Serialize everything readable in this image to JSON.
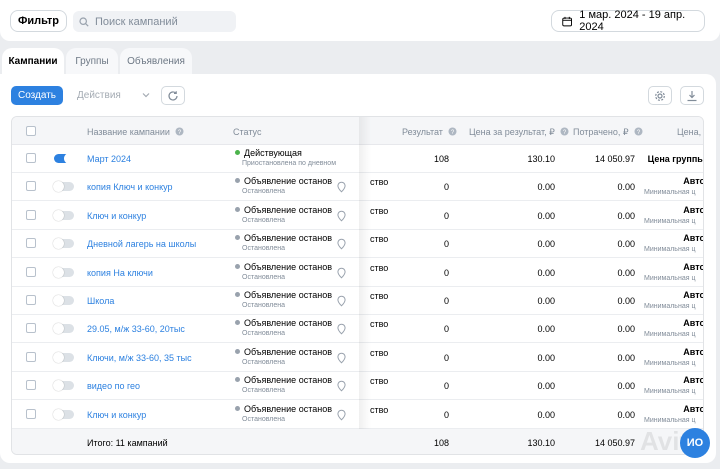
{
  "toolbar": {
    "filter_label": "Фильтр",
    "search_placeholder": "Поиск кампаний",
    "date_range": "1 мар. 2024 - 19 апр. 2024"
  },
  "tabs": [
    {
      "label": "Кампании",
      "active": true
    },
    {
      "label": "Группы",
      "active": false
    },
    {
      "label": "Объявления",
      "active": false
    }
  ],
  "actions": {
    "create_label": "Создать",
    "actions_label": "Действия"
  },
  "table": {
    "columns": {
      "name": "Название кампании",
      "status": "Статус",
      "result": "Результат",
      "cost_per_result": "Цена за результат, ₽",
      "spent": "Потрачено, ₽",
      "price": "Цена,"
    },
    "rows": [
      {
        "name": "Март 2024",
        "enabled": true,
        "status": "Действующая",
        "status_sub": "Приостановлена по дневном",
        "status_color": "#4bb34b",
        "obj": "",
        "result": "108",
        "cpr": "130.10",
        "spent": "14 050.97",
        "bid": "Цена группы",
        "bid_sub": ""
      },
      {
        "name": "копия Ключ и конкур",
        "enabled": false,
        "status": "Объявление останов",
        "status_sub": "Остановлена",
        "status_color": "#99a2ad",
        "obj": "ство",
        "result": "0",
        "cpr": "0.00",
        "spent": "0.00",
        "bid": "Авто",
        "bid_sub": "Минимальная ц"
      },
      {
        "name": "Ключ и конкур",
        "enabled": false,
        "status": "Объявление останов",
        "status_sub": "Остановлена",
        "status_color": "#99a2ad",
        "obj": "ство",
        "result": "0",
        "cpr": "0.00",
        "spent": "0.00",
        "bid": "Авто",
        "bid_sub": "Минимальная ц"
      },
      {
        "name": "Дневной лагерь на школы",
        "enabled": false,
        "status": "Объявление останов",
        "status_sub": "Остановлена",
        "status_color": "#99a2ad",
        "obj": "ство",
        "result": "0",
        "cpr": "0.00",
        "spent": "0.00",
        "bid": "Авто",
        "bid_sub": "Минимальная ц"
      },
      {
        "name": "копия На ключи",
        "enabled": false,
        "status": "Объявление останов",
        "status_sub": "Остановлена",
        "status_color": "#99a2ad",
        "obj": "ство",
        "result": "0",
        "cpr": "0.00",
        "spent": "0.00",
        "bid": "Авто",
        "bid_sub": "Минимальная ц"
      },
      {
        "name": "Школа",
        "enabled": false,
        "status": "Объявление останов",
        "status_sub": "Остановлена",
        "status_color": "#99a2ad",
        "obj": "ство",
        "result": "0",
        "cpr": "0.00",
        "spent": "0.00",
        "bid": "Авто",
        "bid_sub": "Минимальная ц"
      },
      {
        "name": "29.05, м/ж 33-60, 20тыс",
        "enabled": false,
        "status": "Объявление останов",
        "status_sub": "Остановлена",
        "status_color": "#99a2ad",
        "obj": "ство",
        "result": "0",
        "cpr": "0.00",
        "spent": "0.00",
        "bid": "Авто",
        "bid_sub": "Минимальная ц"
      },
      {
        "name": "Ключи, м/ж 33-60, 35 тыс",
        "enabled": false,
        "status": "Объявление останов",
        "status_sub": "Остановлена",
        "status_color": "#99a2ad",
        "obj": "ство",
        "result": "0",
        "cpr": "0.00",
        "spent": "0.00",
        "bid": "Авто",
        "bid_sub": "Минимальная ц"
      },
      {
        "name": "видео по гео",
        "enabled": false,
        "status": "Объявление останов",
        "status_sub": "Остановлена",
        "status_color": "#99a2ad",
        "obj": "ство",
        "result": "0",
        "cpr": "0.00",
        "spent": "0.00",
        "bid": "Авто",
        "bid_sub": "Минимальная ц"
      },
      {
        "name": "Ключ и конкур",
        "enabled": false,
        "status": "Объявление останов",
        "status_sub": "Остановлена",
        "status_color": "#99a2ad",
        "obj": "ство",
        "result": "0",
        "cpr": "0.00",
        "spent": "0.00",
        "bid": "Авто",
        "bid_sub": "Минимальная ц"
      }
    ],
    "footer": {
      "total_label": "Итого: 11 кампаний",
      "result": "108",
      "cpr": "130.10",
      "spent": "14 050.97"
    }
  },
  "badge_text": "ИО",
  "watermark": "Avito",
  "colors": {
    "accent": "#2d81e0",
    "active_dot": "#4bb34b",
    "stopped_dot": "#99a2ad"
  }
}
